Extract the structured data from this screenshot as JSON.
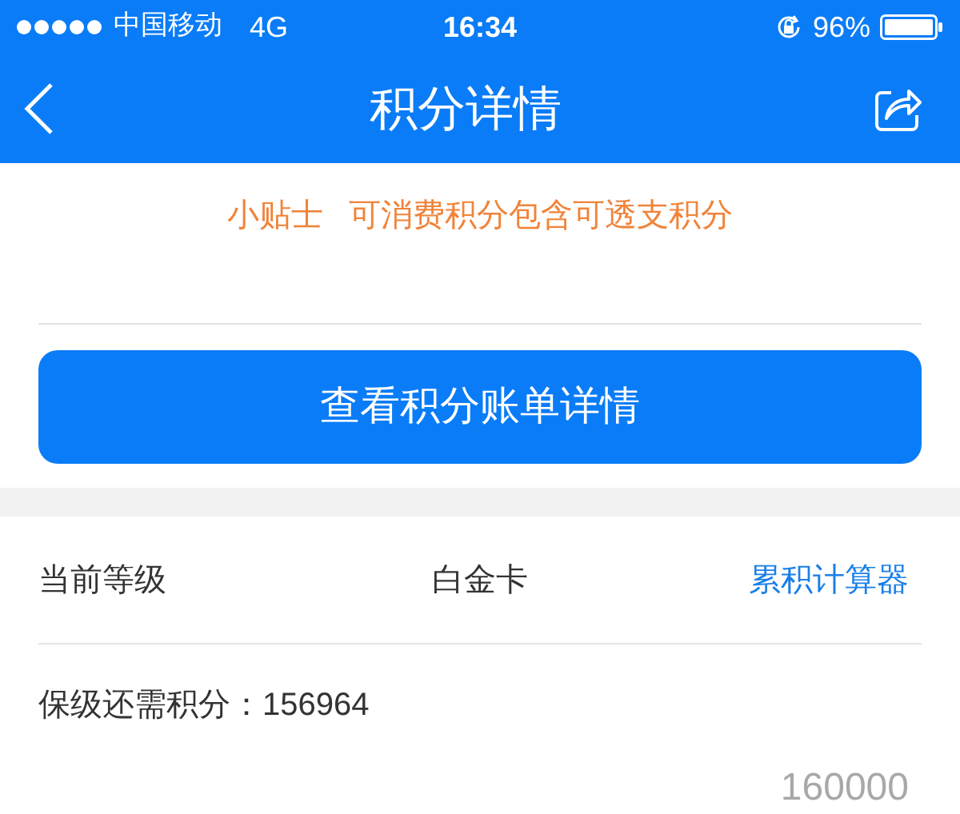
{
  "status_bar": {
    "carrier": "中国移动",
    "network": "4G",
    "time": "16:34",
    "battery": "96%"
  },
  "nav_bar": {
    "title": "积分详情"
  },
  "tip": {
    "label": "小贴士",
    "text": "可消费积分包含可透支积分"
  },
  "bill_button": {
    "label": "查看积分账单详情"
  },
  "level_row": {
    "label": "当前等级",
    "value": "白金卡",
    "link": "累积计算器"
  },
  "retain_points": {
    "text": "保级还需积分：156964"
  },
  "progress": {
    "target": "160000"
  }
}
